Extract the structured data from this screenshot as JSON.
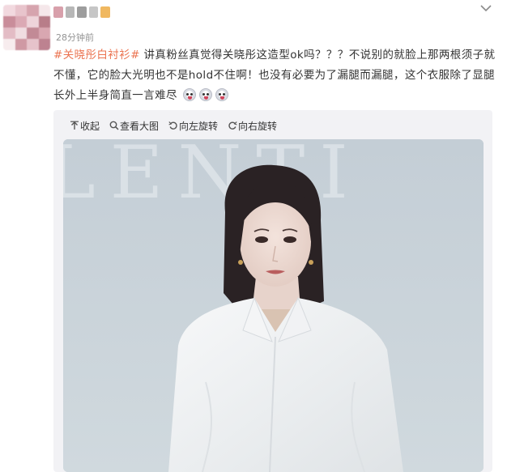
{
  "header": {
    "timestamp": "28分钟前",
    "expand_icon": "chevron-down-icon",
    "avatar_colors": [
      "#f2d9df",
      "#e8c4cc",
      "#d6a4ae",
      "#f5e7ea",
      "#c98d9a",
      "#dba9b4",
      "#eed4da",
      "#b87d89",
      "#e3bcc5",
      "#f0dde1",
      "#c28a96",
      "#d9a7b1",
      "#f7ecee",
      "#cf99a4",
      "#e6c3cb",
      "#bd8290"
    ],
    "username_colors": [
      "#d8a0ab",
      "#b7b7b7",
      "#9d9d9d",
      "#c6c6c6",
      "#f0b860"
    ]
  },
  "post": {
    "hashtag": "#关晓彤白衬衫#",
    "text": "讲真粉丝真觉得关晓彤这造型ok吗？？？不说别的就脸上那两根须子就不懂，它的脸大光明也不是hold不住啊！也没有必要为了漏腿而漏腿，这个衣服除了显腿长外上半身简直一言难尽",
    "emoji_icons": [
      "smirk-emoji-icon",
      "smirk-emoji-icon",
      "smirk-emoji-icon"
    ],
    "hashtag_color": "#eb7350"
  },
  "media": {
    "tools": [
      {
        "icon": "collapse-icon",
        "label": "收起"
      },
      {
        "icon": "search-icon",
        "label": "查看大图"
      },
      {
        "icon": "rotate-left-icon",
        "label": "向左旋转"
      },
      {
        "icon": "rotate-right-icon",
        "label": "向右旋转"
      }
    ],
    "photo_backdrop_text": "LENTI"
  }
}
